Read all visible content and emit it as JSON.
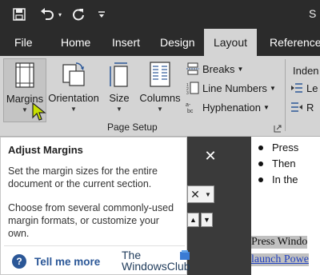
{
  "titlebar": {
    "save_icon": "save-icon",
    "undo_icon": "undo-icon",
    "undo_dropdown_icon": "chevron-down-icon",
    "redo_icon": "redo-icon",
    "customize_icon": "customize-toolbar-icon",
    "title_fragment": "S"
  },
  "tabs": [
    {
      "label": "File"
    },
    {
      "label": "Home"
    },
    {
      "label": "Insert"
    },
    {
      "label": "Design"
    },
    {
      "label": "Layout",
      "active": true
    },
    {
      "label": "References"
    }
  ],
  "ribbon": {
    "margins": {
      "label": "Margins",
      "icon": "margins-icon"
    },
    "orientation": {
      "label": "Orientation",
      "icon": "orientation-icon"
    },
    "size": {
      "label": "Size",
      "icon": "size-icon"
    },
    "columns": {
      "label": "Columns",
      "icon": "columns-icon"
    },
    "breaks": {
      "label": "Breaks",
      "icon": "breaks-icon"
    },
    "line_numbers": {
      "label": "Line Numbers",
      "icon": "line-numbers-icon"
    },
    "hyphenation": {
      "label": "Hyphenation",
      "icon": "hyphenation-icon"
    },
    "group_label": "Page Setup",
    "indent_fragment": "Inden",
    "left_fragment": "Le",
    "right_fragment": "R"
  },
  "tooltip": {
    "title": "Adjust Margins",
    "p1": "Set the margin sizes for the entire document or the current section.",
    "p2": "Choose from several commonly-used margin formats, or customize your own.",
    "more": "Tell me more"
  },
  "document": {
    "bullets": [
      "Press",
      "Then",
      "In the"
    ],
    "line1": "Press Windo",
    "line2": "launch Powe"
  },
  "watermark": {
    "line1": "The",
    "line2": "WindowsClub"
  },
  "colors": {
    "titlebar": "#2b2b2b",
    "ribbon": "#d4d4d4",
    "link": "#1f3fbf",
    "tell_more": "#2b5797"
  }
}
